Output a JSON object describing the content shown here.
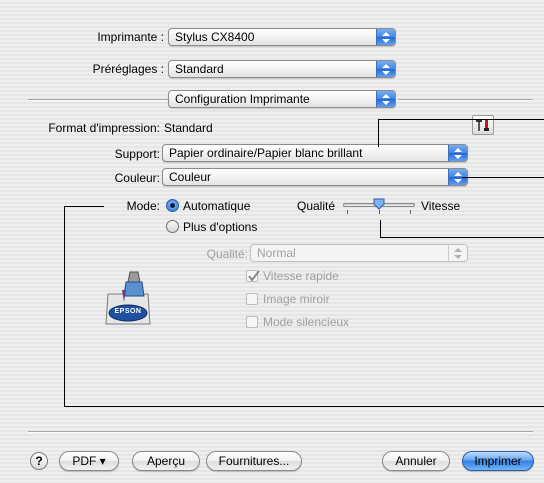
{
  "printer": {
    "label": "Imprimante :",
    "value": "Stylus CX8400"
  },
  "presets": {
    "label": "Préréglages :",
    "value": "Standard"
  },
  "pane": {
    "value": "Configuration Imprimante"
  },
  "paper_size": {
    "label": "Format d'impression:",
    "value": "Standard"
  },
  "support": {
    "label": "Support:",
    "value": "Papier ordinaire/Papier blanc brillant"
  },
  "color": {
    "label": "Couleur:",
    "value": "Couleur"
  },
  "mode": {
    "label": "Mode:",
    "automatic": "Automatique",
    "more_options": "Plus d'options",
    "selected": "Automatique",
    "slider_left": "Qualité",
    "slider_right": "Vitesse",
    "slider_position": 0.5
  },
  "quality": {
    "label": "Qualité:",
    "value": "Normal"
  },
  "options": {
    "high_speed": {
      "label": "Vitesse rapide",
      "checked": true
    },
    "mirror": {
      "label": "Image miroir",
      "checked": false
    },
    "silent": {
      "label": "Mode silencieux",
      "checked": false
    }
  },
  "logo": {
    "text": "EPSON"
  },
  "buttons": {
    "help": "?",
    "pdf": "PDF ▾",
    "preview": "Aperçu",
    "supplies": "Fournitures...",
    "cancel": "Annuler",
    "print": "Imprimer"
  },
  "colors": {
    "accent": "#3f86e6",
    "epson_blue": "#1f4fa0"
  }
}
